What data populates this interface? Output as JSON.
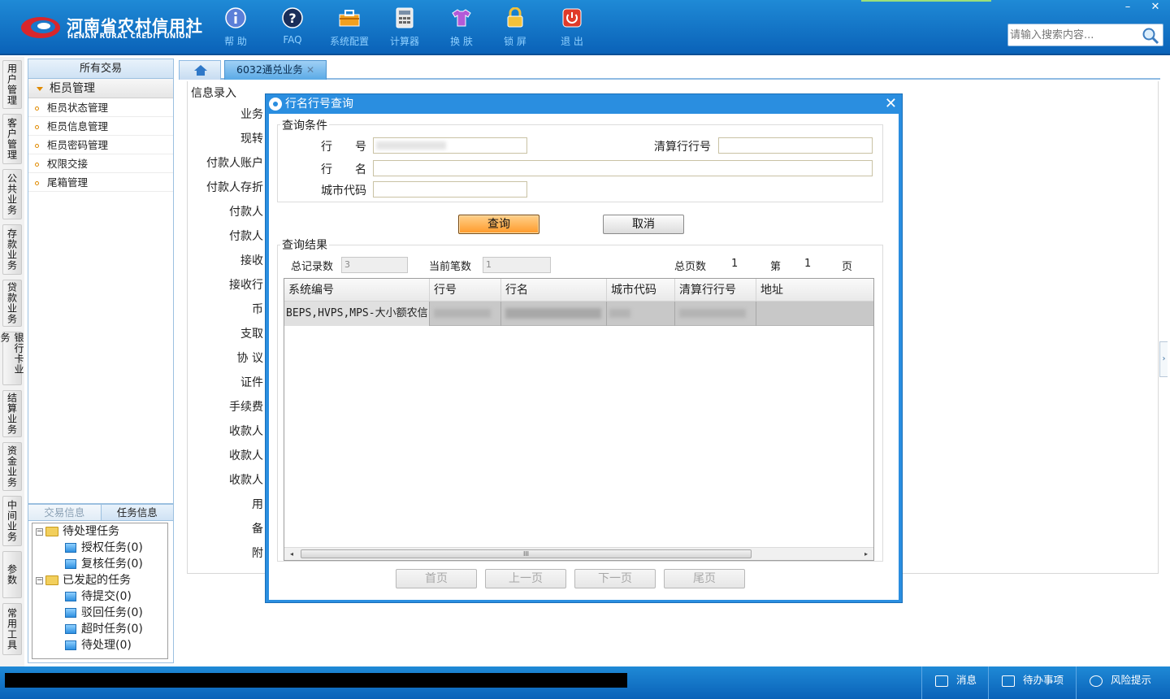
{
  "header": {
    "logo_cn": "河南省农村信用社",
    "logo_en": "HENAN RURAL CREDIT UNION",
    "tools": [
      {
        "label": "帮 助",
        "icon": "info-icon"
      },
      {
        "label": "FAQ",
        "icon": "question-icon"
      },
      {
        "label": "系统配置",
        "icon": "toolbox-icon"
      },
      {
        "label": "计算器",
        "icon": "calculator-icon"
      },
      {
        "label": "换 肤",
        "icon": "shirt-icon"
      },
      {
        "label": "锁 屏",
        "icon": "lock-icon"
      },
      {
        "label": "退 出",
        "icon": "power-icon"
      }
    ],
    "search_placeholder": "请输入搜索内容...",
    "window_controls": {
      "minimize": "–",
      "close": "✕"
    }
  },
  "vertical_tabs": [
    "用户管理",
    "客户管理",
    "公共业务",
    "存款业务",
    "贷款业务",
    "银行卡业务",
    "结算业务",
    "资金业务",
    "中间业务",
    "参数",
    "常用工具"
  ],
  "nav": {
    "header": "所有交易",
    "group": "柜员管理",
    "items": [
      "柜员状态管理",
      "柜员信息管理",
      "柜员密码管理",
      "权限交接",
      "尾箱管理"
    ]
  },
  "tasks": {
    "tabs": [
      "交易信息",
      "任务信息"
    ],
    "tree": [
      {
        "label": "待处理任务",
        "level": 0,
        "type": "folder"
      },
      {
        "label": "授权任务(0)",
        "level": 1,
        "type": "item"
      },
      {
        "label": "复核任务(0)",
        "level": 1,
        "type": "item"
      },
      {
        "label": "已发起的任务",
        "level": 0,
        "type": "folder"
      },
      {
        "label": "待提交(0)",
        "level": 1,
        "type": "item"
      },
      {
        "label": "驳回任务(0)",
        "level": 1,
        "type": "item"
      },
      {
        "label": "超时任务(0)",
        "level": 1,
        "type": "item"
      },
      {
        "label": "待处理(0)",
        "level": 1,
        "type": "item"
      }
    ]
  },
  "main": {
    "home_tab_icon": "home-icon",
    "active_tab": "6032通兑业务",
    "tab_close": "✕",
    "form_title": "信息录入",
    "form_labels": [
      "业务",
      "现转",
      "付款人账户",
      "付款人存折",
      "付款人",
      "付款人",
      "接收",
      "接收行",
      "币",
      "支取",
      "协 议",
      "证件",
      "手续费",
      "收款人",
      "收款人",
      "收款人",
      "用",
      "备",
      "附"
    ]
  },
  "dialog": {
    "title": "行名行号查询",
    "close": "✕",
    "criteria_legend": "查询条件",
    "labels": {
      "bank_no": "行　　号",
      "clearing_no": "清算行行号",
      "bank_name": "行　　名",
      "city_code": "城市代码"
    },
    "values": {
      "bank_no": "",
      "clearing_no": "",
      "bank_name": "",
      "city_code": ""
    },
    "buttons": {
      "query": "查询",
      "cancel": "取消"
    },
    "result_legend": "查询结果",
    "summary": {
      "total_label": "总记录数",
      "total_value": "3",
      "current_label": "当前笔数",
      "current_value": "1",
      "pages_label": "总页数",
      "pages_value": "1",
      "page_prefix": "第",
      "page_value": "1",
      "page_suffix": "页"
    },
    "columns": [
      "系统编号",
      "行号",
      "行名",
      "城市代码",
      "清算行行号",
      "地址"
    ],
    "rows": [
      {
        "system_no": "BEPS,HVPS,MPS-大小额农信",
        "bank_no": "",
        "bank_name": "",
        "city_code": "",
        "clearing_no": "",
        "address": ""
      }
    ],
    "pager": [
      "首页",
      "上一页",
      "下一页",
      "尾页"
    ]
  },
  "statusbar": {
    "items": [
      {
        "label": "消息",
        "icon": "mail-icon"
      },
      {
        "label": "待办事项",
        "icon": "checkbox-icon"
      },
      {
        "label": "风险提示",
        "icon": "chat-bubble-icon"
      }
    ]
  }
}
